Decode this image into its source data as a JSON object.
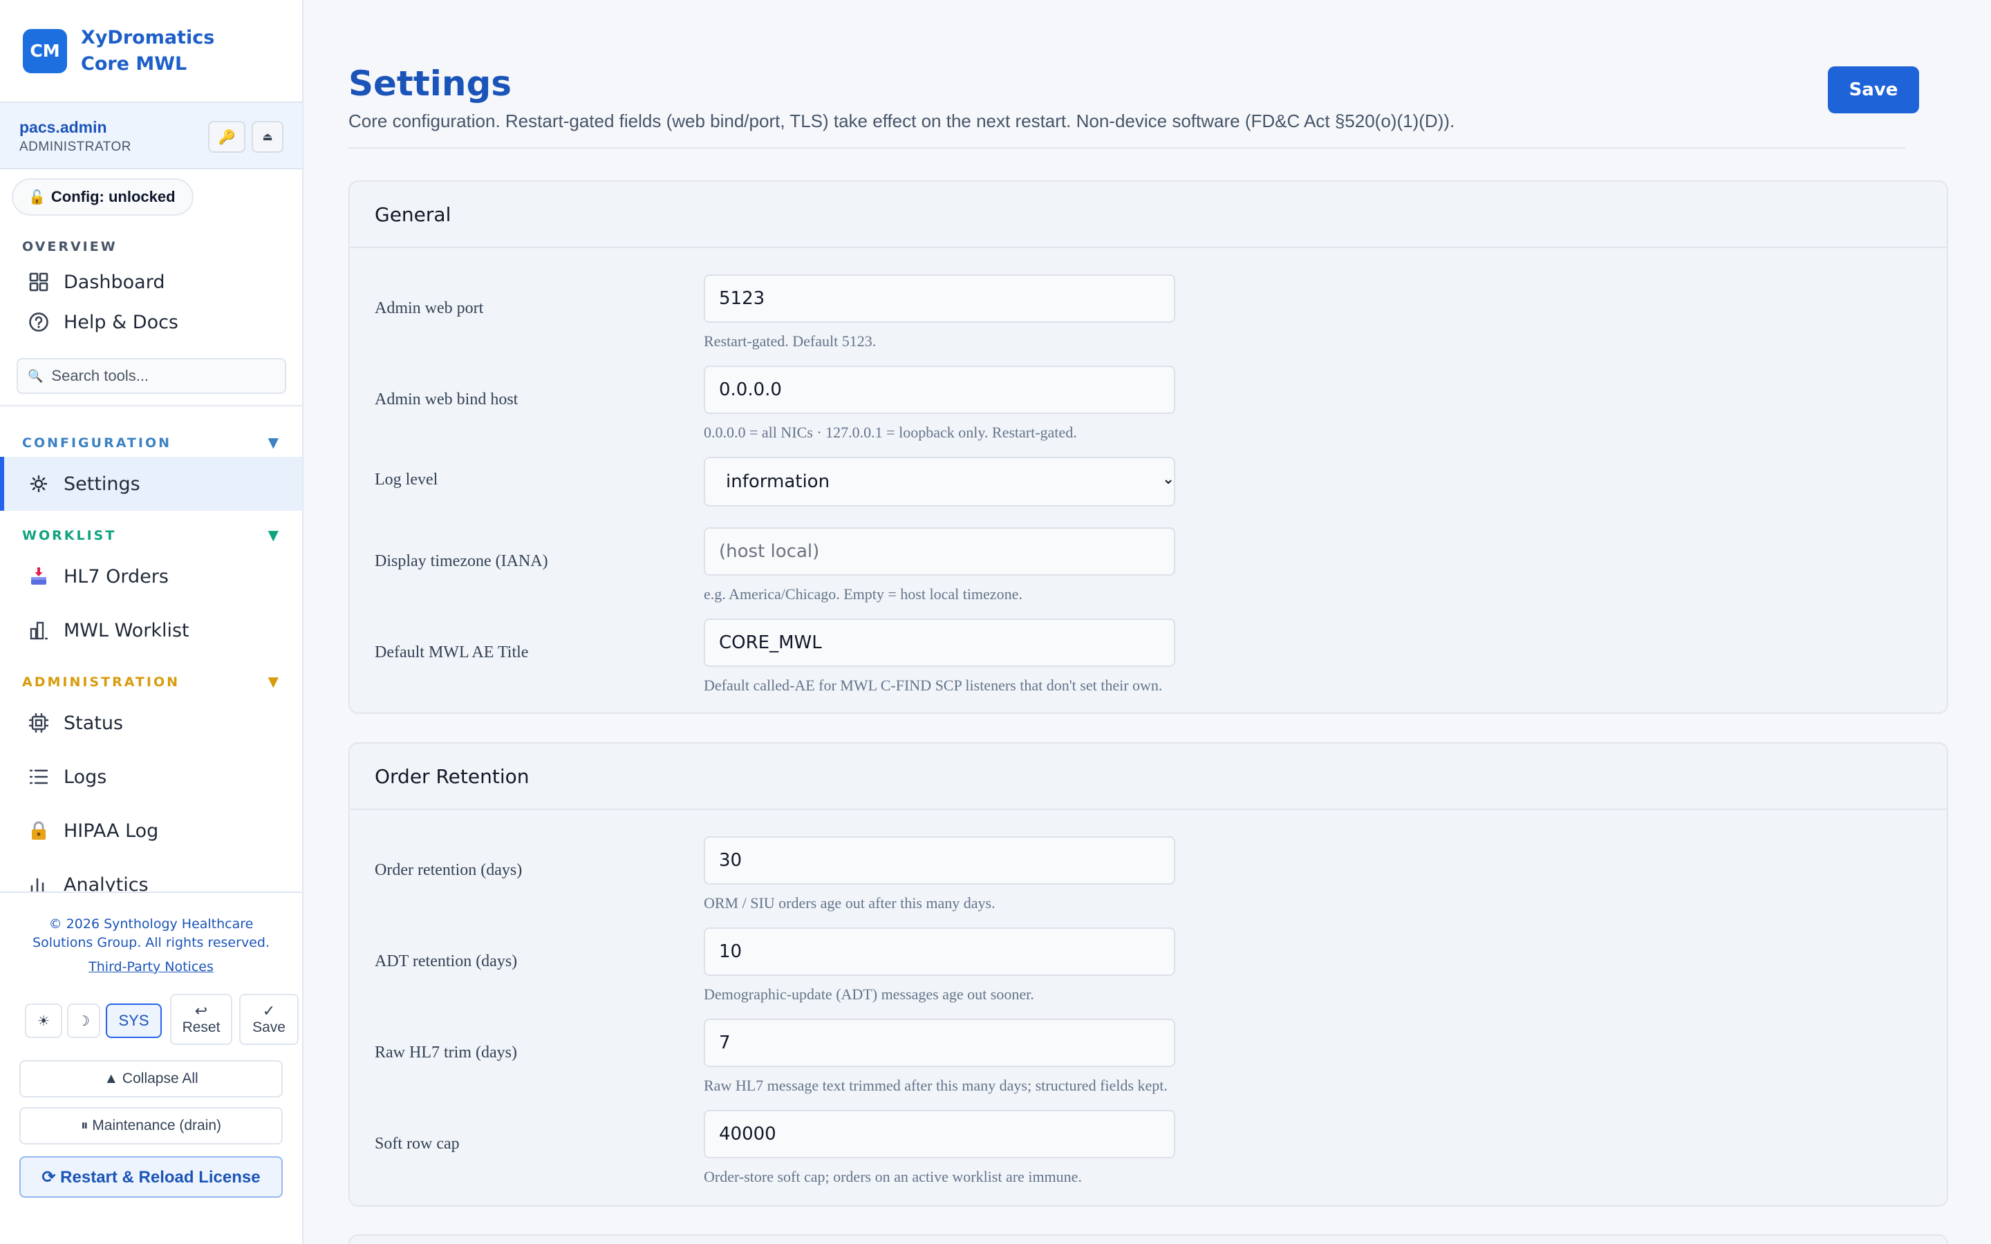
{
  "brand": {
    "logo": "CM",
    "line1": "XyDromatics",
    "line2": "Core MWL"
  },
  "user": {
    "name": "pacs.admin",
    "role": "ADMINISTRATOR",
    "key_icon": "🔑",
    "eject_icon": "⏏"
  },
  "lock": {
    "icon": "🔓",
    "label": "Config: unlocked"
  },
  "sections": {
    "overview": {
      "label": "OVERVIEW",
      "color": "#475569"
    },
    "configuration": {
      "label": "CONFIGURATION",
      "color": "#3b82c4",
      "caret": "▼"
    },
    "worklist": {
      "label": "WORKLIST",
      "color": "#10a37f",
      "caret": "▼"
    },
    "administration": {
      "label": "ADMINISTRATION",
      "color": "#d89b0c",
      "caret": "▼"
    }
  },
  "nav": {
    "dashboard": "Dashboard",
    "help": "Help & Docs",
    "settings": "Settings",
    "hl7_orders": "HL7 Orders",
    "mwl_worklist": "MWL Worklist",
    "status": "Status",
    "logs": "Logs",
    "hipaa_log": "HIPAA Log",
    "analytics": "Analytics"
  },
  "search": {
    "placeholder": "Search tools..."
  },
  "footer": {
    "copyright_1": "© 2026 Synthology Healthcare",
    "copyright_2": "Solutions Group. All rights reserved.",
    "notices": "Third-Party Notices",
    "theme_light": "☀",
    "theme_dark": "☽",
    "theme_sys": "SYS",
    "reset_glyph": "↩",
    "reset": "Reset",
    "save_glyph": "✓",
    "save": "Save",
    "collapse_all": "▲ Collapse All",
    "maintenance": "⏸ Maintenance (drain)",
    "restart": "⟳ Restart & Reload License"
  },
  "page": {
    "title": "Settings",
    "subtitle": "Core configuration. Restart-gated fields (web bind/port, TLS) take effect on the next restart. Non-device software (FD&C Act §520(o)(1)(D)).",
    "save": "Save"
  },
  "general": {
    "title": "General",
    "fields": [
      {
        "label": "Admin web port",
        "value": "5123",
        "help": "Restart-gated. Default 5123."
      },
      {
        "label": "Admin web bind host",
        "value": "0.0.0.0",
        "help": "0.0.0.0 = all NICs · 127.0.0.1 = loopback only. Restart-gated."
      },
      {
        "label": "Log level",
        "value": "information",
        "help": ""
      },
      {
        "label": "Display timezone (IANA)",
        "value": "",
        "placeholder": "(host local)",
        "help": "e.g. America/Chicago. Empty = host local timezone."
      },
      {
        "label": "Default MWL AE Title",
        "value": "CORE_MWL",
        "help": "Default called-AE for MWL C-FIND SCP listeners that don't set their own."
      }
    ]
  },
  "retention": {
    "title": "Order Retention",
    "fields": [
      {
        "label": "Order retention (days)",
        "value": "30",
        "help": "ORM / SIU orders age out after this many days."
      },
      {
        "label": "ADT retention (days)",
        "value": "10",
        "help": "Demographic-update (ADT) messages age out sooner."
      },
      {
        "label": "Raw HL7 trim (days)",
        "value": "7",
        "help": "Raw HL7 message text trimmed after this many days; structured fields kept."
      },
      {
        "label": "Soft row cap",
        "value": "40000",
        "help": "Order-store soft cap; orders on an active worklist are immune."
      }
    ]
  }
}
